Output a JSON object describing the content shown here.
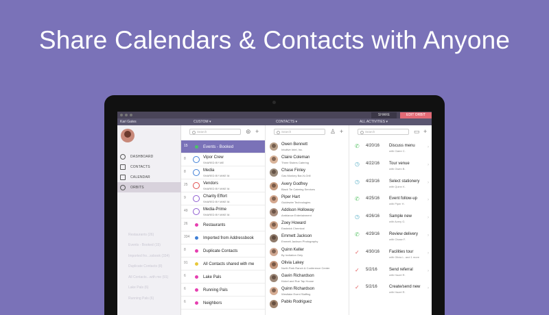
{
  "headline": "Share Calendars & Contacts with Anyone",
  "titlebar": {
    "share_label": "SHARE",
    "edit_label": "EDIT ORBIT"
  },
  "header": {
    "user": "Kari Gates",
    "col1": "CUSTOM ▾",
    "col2": "CONTACTS ▾",
    "col3": "ALL ACTIVITIES ▾"
  },
  "sidebar": {
    "items": [
      {
        "label": "DASHBOARD",
        "icon": "dashboard-icon"
      },
      {
        "label": "CONTACTS",
        "icon": "contacts-icon"
      },
      {
        "label": "CALENDAR",
        "icon": "calendar-icon"
      },
      {
        "label": "ORBITS",
        "icon": "orbits-icon",
        "active": true
      }
    ],
    "faded": [
      "Restaurants (26)",
      "Events - Booked (15)",
      "Imported fro...ssbook (334)",
      "Duplicate Contacts (8)",
      "All Contacts...with me (91)",
      "Lake Pals (6)",
      "Running Pals (6)"
    ]
  },
  "search": {
    "placeholder": "Search"
  },
  "orbits": [
    {
      "count": "15",
      "title": "Events - Booked",
      "sub": "",
      "color": "#4cc26a",
      "style": "dot",
      "selected": true
    },
    {
      "count": "8",
      "title": "Vipor Crew",
      "sub": "SHARED BY ME",
      "color": "#3f7fd6",
      "style": "ring"
    },
    {
      "count": "8",
      "title": "Media",
      "sub": "SHARED BY MIKE M.",
      "color": "#3f7fd6",
      "style": "ring"
    },
    {
      "count": "25",
      "title": "Vendors",
      "sub": "SHARED BY MIKE M.",
      "color": "#e04b4b",
      "style": "ring"
    },
    {
      "count": "9",
      "title": "Charity Effort",
      "sub": "SHARED BY MIKE M.",
      "color": "#8e5bd0",
      "style": "ring"
    },
    {
      "count": "49",
      "title": "Media-Prime",
      "sub": "SHARED BY MIKE M.",
      "color": "#8e5bd0",
      "style": "ring"
    },
    {
      "count": "26",
      "title": "Restaurants",
      "sub": "",
      "color": "#e63fb0",
      "style": "dot"
    },
    {
      "count": "334",
      "title": "Imported from Addressbook",
      "sub": "",
      "color": "#3f7fd6",
      "style": "dot"
    },
    {
      "count": "8",
      "title": "Duplicate Contacts",
      "sub": "",
      "color": "#e63fb0",
      "style": "dot"
    },
    {
      "count": "91",
      "title": "All Contacts shared with me",
      "sub": "",
      "color": "#e8c83a",
      "style": "dot"
    },
    {
      "count": "6",
      "title": "Lake Pals",
      "sub": "",
      "color": "#e63fb0",
      "style": "dot"
    },
    {
      "count": "6",
      "title": "Running Pals",
      "sub": "",
      "color": "#e63fb0",
      "style": "dot"
    },
    {
      "count": "6",
      "title": "Neighbors",
      "sub": "",
      "color": "#e63fb0",
      "style": "dot"
    }
  ],
  "contacts": [
    {
      "name": "Owen Bennett",
      "org": "Intuitive Intel, Inc.",
      "color": "#b8a08a"
    },
    {
      "name": "Claire Coleman",
      "org": "Three Sisters Catering",
      "color": "#d9b49a"
    },
    {
      "name": "Chase Finley",
      "org": "Gas Monkey Bar-N-Grill",
      "color": "#9a8a7a"
    },
    {
      "name": "Avery Godfrey",
      "org": "Black Tie Catering Services",
      "color": "#c49a7e"
    },
    {
      "name": "Piper Hart",
      "org": "Guidewire Technologies",
      "color": "#d4a88f"
    },
    {
      "name": "Addison Holloway",
      "org": "Ambiance Entertainment",
      "color": "#a88c7c"
    },
    {
      "name": "Zoey Howard",
      "org": "Eastwick Chemical",
      "color": "#c9a085"
    },
    {
      "name": "Emmett Jackson",
      "org": "Emmett Jackson Photography",
      "color": "#8f7a6a"
    },
    {
      "name": "Quinn Keller",
      "org": "By Invitation Only",
      "color": "#d0a892"
    },
    {
      "name": "Olivia Lakey",
      "org": "North Park Ranch & Conference Center",
      "color": "#c2957a"
    },
    {
      "name": "Gavin Richardson",
      "org": "Kickel and Rue Tap House",
      "color": "#9d8878"
    },
    {
      "name": "Quinn Richardson",
      "org": "Westlake Event Staffing",
      "color": "#d6ad94"
    },
    {
      "name": "Pablo Rodriguez",
      "org": "",
      "color": "#a0846e"
    }
  ],
  "activities": [
    {
      "date": "4/20/16",
      "title": "Discuss menu",
      "sub": "with Claire C.",
      "icon": "phone-icon",
      "color": "#5cc46a"
    },
    {
      "date": "4/22/16",
      "title": "Tour venue",
      "sub": "with Owen B.",
      "icon": "clock-icon",
      "color": "#5ab0c8"
    },
    {
      "date": "4/23/16",
      "title": "Select stationery",
      "sub": "with Quinn K.",
      "icon": "clock-icon",
      "color": "#5ab0c8"
    },
    {
      "date": "4/25/16",
      "title": "Event follow-up",
      "sub": "with Piper H.",
      "icon": "phone-icon",
      "color": "#5cc46a"
    },
    {
      "date": "4/26/16",
      "title": "Sample new",
      "sub": "with Avery G.",
      "icon": "clock-icon",
      "color": "#5ab0c8"
    },
    {
      "date": "4/29/16",
      "title": "Review delivery",
      "sub": "with Chase F.",
      "icon": "phone-icon",
      "color": "#5cc46a"
    },
    {
      "date": "4/30/16",
      "title": "Facilities tour",
      "sub": "with Olivia L. and 1 more",
      "icon": "check-icon",
      "color": "#e25a5a"
    },
    {
      "date": "5/2/16",
      "title": "Send referral",
      "sub": "with Hazel R.",
      "icon": "check-icon",
      "color": "#e25a5a"
    },
    {
      "date": "5/2/16",
      "title": "Create/send new",
      "sub": "with Hazel R.",
      "icon": "check-icon",
      "color": "#e25a5a"
    }
  ]
}
